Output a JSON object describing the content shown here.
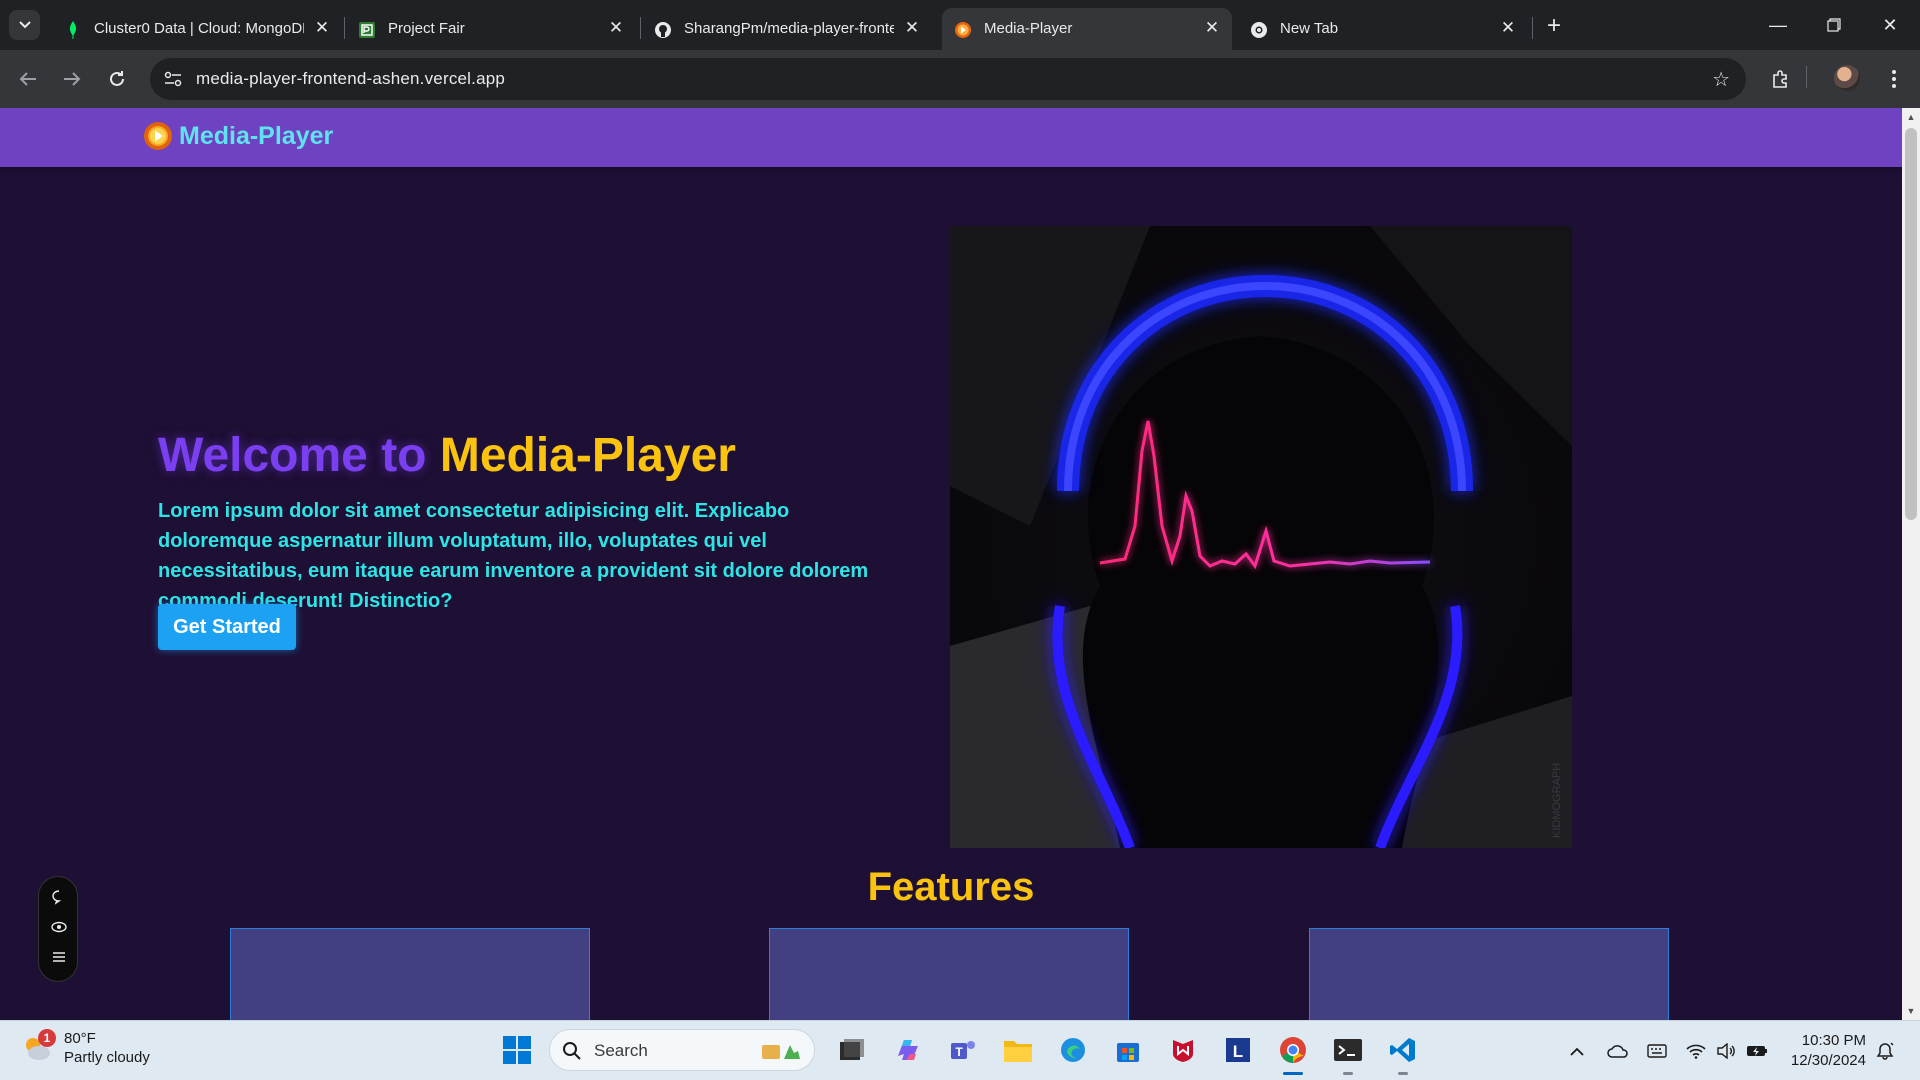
{
  "browser": {
    "tabs": [
      {
        "title": "Cluster0 Data | Cloud: MongoDB",
        "favicon": "mongodb-leaf-icon",
        "active": false
      },
      {
        "title": "Project Fair",
        "favicon": "project-fair-icon",
        "active": false
      },
      {
        "title": "SharangPm/media-player-frontend",
        "favicon": "github-icon",
        "active": false
      },
      {
        "title": "Media-Player",
        "favicon": "media-player-icon",
        "active": true
      },
      {
        "title": "New Tab",
        "favicon": "chrome-icon",
        "active": false
      }
    ],
    "url": "media-player-frontend-ashen.vercel.app"
  },
  "site": {
    "brand": "Media-Player",
    "hero": {
      "title_part1": "Welcome to",
      "title_part2": "Media-Player",
      "description": "Lorem ipsum dolor sit amet consectetur adipisicing elit. Explicabo doloremque aspernatur illum voluptatum, illo, voluptates qui vel necessitatibus, eum itaque earum inventore a provident sit dolore dolorem commodi deserunt! Distinctio?",
      "cta_label": "Get Started",
      "image_caption": "KIDMOGRAPH"
    },
    "features_title": "Features",
    "feature_cards": [
      {},
      {},
      {}
    ]
  },
  "taskbar": {
    "weather_temp": "80°F",
    "weather_desc": "Partly cloudy",
    "weather_badge": "1",
    "search_label": "Search",
    "apps": [
      "task-view-icon",
      "copilot-icon",
      "teams-icon",
      "file-explorer-icon",
      "edge-icon",
      "microsoft-store-icon",
      "mcafee-icon",
      "l-app-icon",
      "chrome-icon",
      "terminal-icon",
      "vscode-icon"
    ],
    "time": "10:30 PM",
    "date": "12/30/2024"
  },
  "colors": {
    "nav_bg": "#6f42c1",
    "page_bg": "#1e0f35",
    "accent_purple": "#7b3ff2",
    "accent_yellow": "#f9c30f",
    "accent_cyan": "#2ee5e6",
    "button_blue": "#1da1f2"
  }
}
